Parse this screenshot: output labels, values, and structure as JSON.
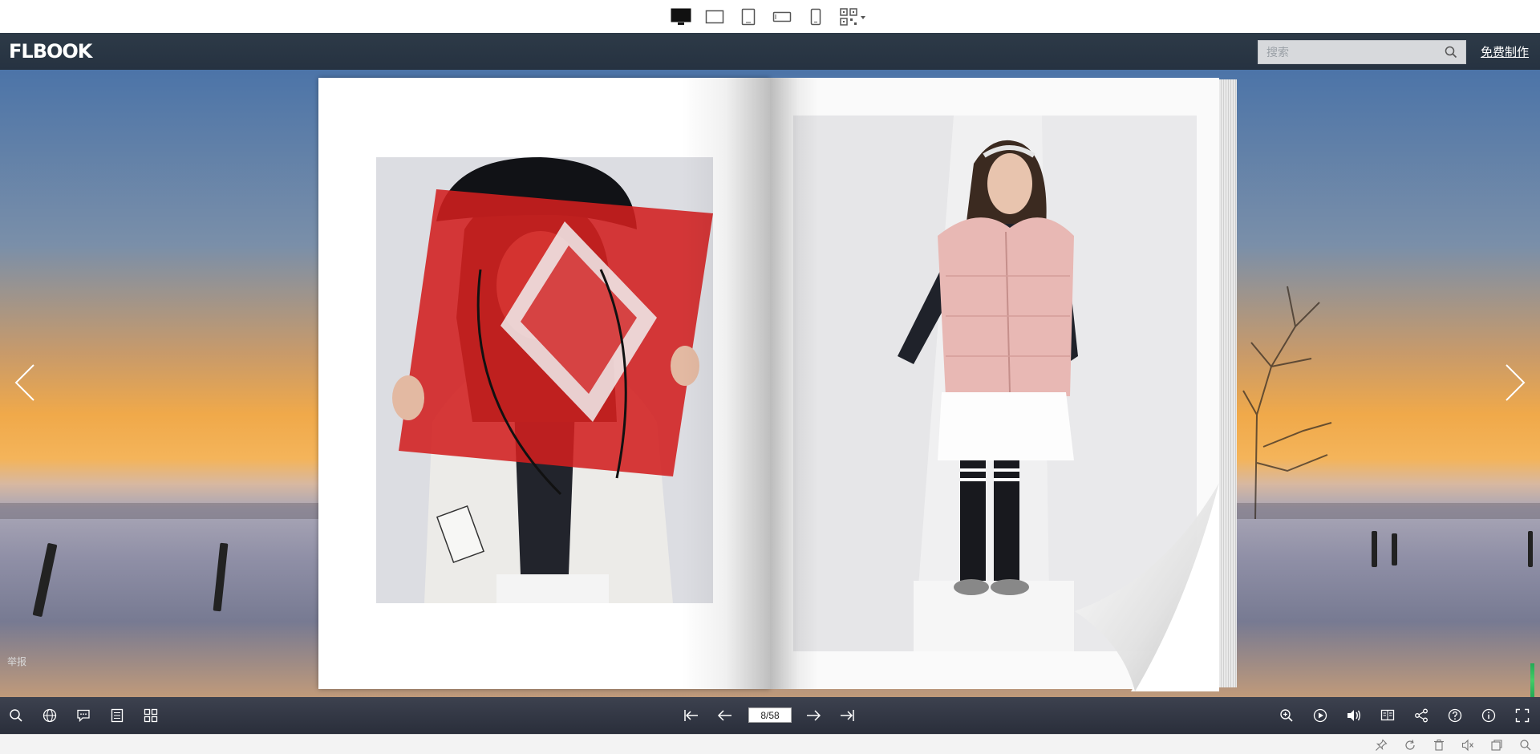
{
  "device_bar": {
    "items": [
      {
        "name": "desktop-view",
        "active": true
      },
      {
        "name": "landscape-tablet-view",
        "active": false
      },
      {
        "name": "tablet-view",
        "active": false
      },
      {
        "name": "landscape-phone-view",
        "active": false
      },
      {
        "name": "phone-view",
        "active": false
      },
      {
        "name": "qrcode-view",
        "active": false
      }
    ]
  },
  "header": {
    "logo": "FLBOOK",
    "search_placeholder": "搜索",
    "free_make_label": "免费制作"
  },
  "stage": {
    "report_label": "举报"
  },
  "pagination": {
    "current": "8/58"
  },
  "colors": {
    "header_bg": "#263241",
    "toolbar_bg": "#1e2330",
    "accent_red": "#d11f1f",
    "vest_pink": "#e8b8b4"
  }
}
